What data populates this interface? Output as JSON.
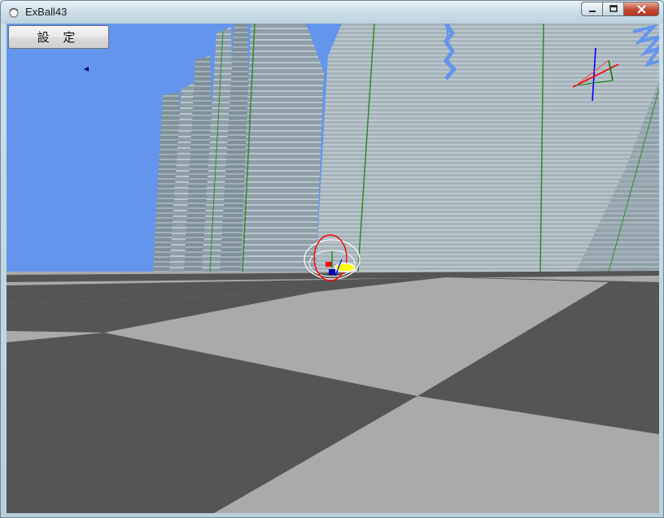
{
  "window": {
    "title": "ExBall43",
    "icon": "ball-app-icon",
    "controls": {
      "minimize_icon": "minimize-icon",
      "maximize_icon": "maximize-icon",
      "close_icon": "close-icon"
    }
  },
  "toolbar": {
    "settings_label": "設 定"
  },
  "scene": {
    "sky_color": "#6495ed",
    "floor_colors": [
      "#555555",
      "#aaaaaa"
    ],
    "wall_color": "#8f9fa8",
    "wall_line_color": "#e6eef2",
    "wall_edge_color": "#2e8b2e",
    "ball_color": "#ffff00",
    "axis_colors": {
      "x": "#ff0000",
      "y": "#008000",
      "z": "#0000ff"
    }
  }
}
